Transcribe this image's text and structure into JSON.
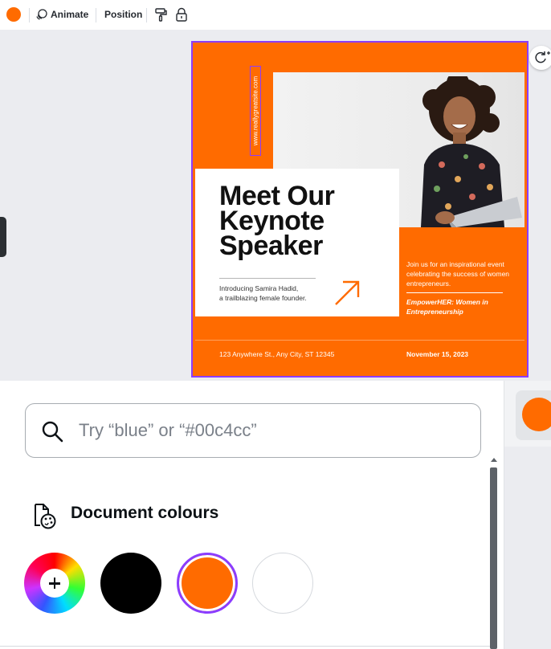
{
  "toolbar": {
    "current_colour": "#ff6b00",
    "animate_label": "Animate",
    "position_label": "Position",
    "icons": [
      "animate-icon",
      "paint-roller-icon",
      "lock-icon"
    ]
  },
  "design": {
    "url_text": "www.reallygreatsite.com",
    "headline": [
      "Meet Our",
      "Keynote",
      "Speaker"
    ],
    "intro": [
      "Introducing Samira Hadid,",
      "a trailblazing female founder."
    ],
    "description": "Join us for an inspirational event celebrating the success of women entrepreneurs.",
    "tagline": "EmpowerHER: Women in Entrepreneurship",
    "address": "123 Anywhere St., Any City, ST 12345",
    "date": "November 15, 2023",
    "accent": "#ff6b00",
    "selection_color": "#8b3dff"
  },
  "panel": {
    "search_placeholder": "Try “blue” or “#00c4cc”",
    "section_title": "Document colours",
    "swatches": [
      {
        "name": "add-colour",
        "color": "rainbow"
      },
      {
        "name": "black",
        "color": "#000000"
      },
      {
        "name": "orange",
        "color": "#ff6b00",
        "selected": true
      },
      {
        "name": "white",
        "color": "#ffffff"
      }
    ]
  },
  "side": {
    "active_colour": "#ff6b00"
  }
}
